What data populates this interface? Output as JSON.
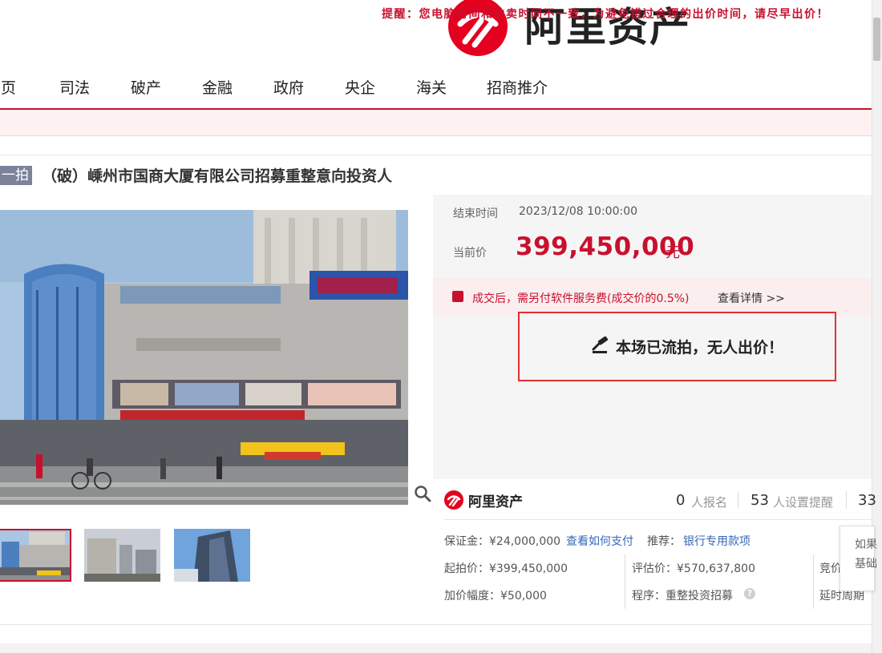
{
  "brand": {
    "name": "阿里资产",
    "color": "#e4001e"
  },
  "nav": {
    "items": [
      "首页",
      "司法",
      "破产",
      "金融",
      "政府",
      "央企",
      "海关",
      "招商推介"
    ]
  },
  "warning": "提醒：您电脑时间和拍卖时间不一致，为避免错过合理的出价时间，请尽早出价！",
  "listing": {
    "status": "一拍",
    "title": "（破）嵊州市国商大厦有限公司招募重整意向投资人"
  },
  "auction": {
    "end_label": "结束时间",
    "end_time": "2023/12/08 10:00:00",
    "price_label": "当前价",
    "price": "399,450,000",
    "price_unit": "元",
    "fee_text": "成交后，需另付软件服务费(成交价的0.5%)",
    "fee_link": "查看详情 >>",
    "passed_text": "本场已流拍，无人出价！"
  },
  "stats": {
    "brand": "阿里资产",
    "registered_num": "0",
    "registered_label": "人报名",
    "reminder_num": "53",
    "reminder_label": "人设置提醒",
    "views_num": "33"
  },
  "info": {
    "deposit": "保证金：¥24,000,000",
    "deposit_link": "查看如何支付",
    "recommend_label": "推荐：",
    "recommend_link": "银行专用款项",
    "start_price": "起拍价：¥399,450,000",
    "eval_price": "评估价：¥570,637,800",
    "bid_cut": "竞价",
    "increment": "加价幅度：¥50,000",
    "procedure": "程序：重整投资招募",
    "delay": "延时周期"
  },
  "tooltip": {
    "line1": "如果",
    "line2": "基础"
  },
  "colors": {
    "accent": "#c8102e",
    "link": "#3567b8",
    "tag": "#7b8299"
  }
}
